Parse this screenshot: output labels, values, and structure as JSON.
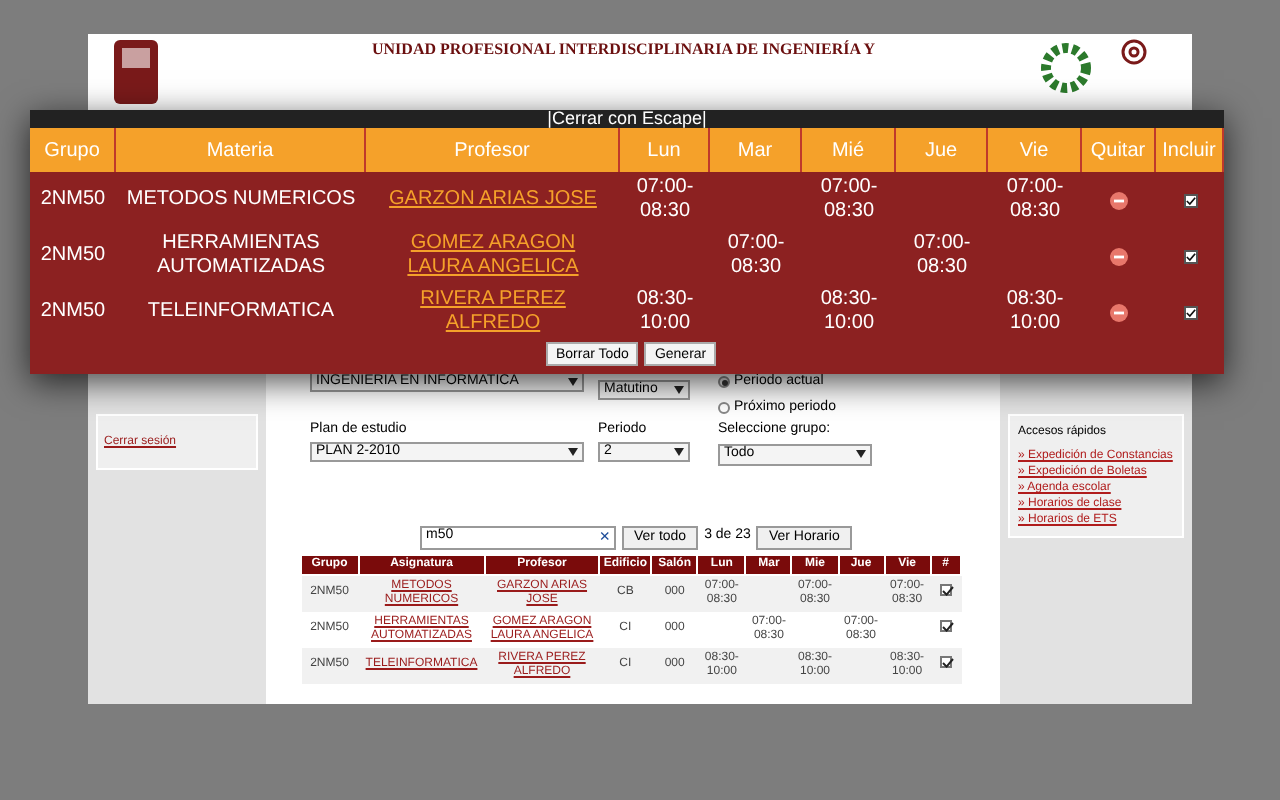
{
  "header": {
    "title": "UNIDAD PROFESIONAL INTERDISCIPLINARIA DE INGENIERÍA Y"
  },
  "overlay": {
    "close_hint": "|Cerrar con Escape|",
    "columns": [
      "Grupo",
      "Materia",
      "Profesor",
      "Lun",
      "Mar",
      "Mié",
      "Jue",
      "Vie",
      "Quitar",
      "Incluir"
    ],
    "rows": [
      {
        "group": "2NM50",
        "subject": "METODOS NUMERICOS",
        "professor": "GARZON ARIAS JOSE",
        "mon": "07:00-08:30",
        "wed": "07:00-08:30",
        "fri": "07:00-08:30",
        "included": true
      },
      {
        "group": "2NM50",
        "subject": "HERRAMIENTAS AUTOMATIZADAS",
        "professor": "GOMEZ ARAGON LAURA ANGELICA",
        "tue": "07:00-08:30",
        "thu": "07:00-08:30",
        "included": true
      },
      {
        "group": "2NM50",
        "subject": "TELEINFORMATICA",
        "professor": "RIVERA PEREZ ALFREDO",
        "mon": "08:30-10:00",
        "wed": "08:30-10:00",
        "fri": "08:30-10:00",
        "included": true
      }
    ],
    "buttons": [
      "Borrar Todo",
      "Generar"
    ]
  },
  "form": {
    "career": "INGENIERIA EN INFORMATICA",
    "shift": "Matutino",
    "plan_label": "Plan de estudio",
    "plan": "PLAN 2-2010",
    "period_label": "Periodo",
    "period": "2",
    "period_options": [
      {
        "label": "Periodo actual",
        "selected": true
      },
      {
        "label": "Próximo periodo",
        "selected": false
      }
    ],
    "group_label": "Seleccione grupo:",
    "group": "Todo"
  },
  "search": {
    "value": "m50",
    "clear": "×",
    "buttons": [
      "Ver todo",
      "Ver Horario"
    ],
    "count": "3 de 23"
  },
  "table": {
    "columns": [
      "Grupo",
      "Asignatura",
      "Profesor",
      "Edificio",
      "Salón",
      "Lun",
      "Mar",
      "Mie",
      "Jue",
      "Vie",
      "#"
    ],
    "rows": [
      {
        "group": "2NM50",
        "subject": "METODOS NUMERICOS",
        "professor": "GARZON ARIAS JOSE",
        "building": "CB",
        "room": "000",
        "mon": "07:00-08:30",
        "wed": "07:00-08:30",
        "fri": "07:00-08:30",
        "checked": true
      },
      {
        "group": "2NM50",
        "subject": "HERRAMIENTAS AUTOMATIZADAS",
        "professor": "GOMEZ ARAGON LAURA ANGELICA",
        "building": "CI",
        "room": "000",
        "tue": "07:00-08:30",
        "thu": "07:00-08:30",
        "checked": true
      },
      {
        "group": "2NM50",
        "subject": "TELEINFORMATICA",
        "professor": "RIVERA PEREZ ALFREDO",
        "building": "CI",
        "room": "000",
        "mon": "08:30-10:00",
        "wed": "08:30-10:00",
        "fri": "08:30-10:00",
        "checked": true
      }
    ]
  },
  "sidebar": {
    "logout": "Cerrar sesión"
  },
  "quick_links": {
    "title": "Accesos rápidos",
    "links": [
      "» Expedición de Constancias",
      "» Expedición de Boletas",
      "» Agenda escolar",
      "» Horarios de clase",
      "» Horarios de ETS"
    ]
  }
}
